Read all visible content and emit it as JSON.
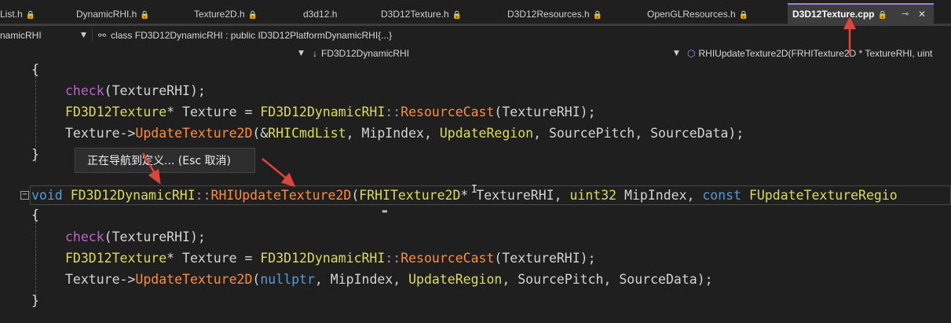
{
  "tabs": [
    {
      "label": "List.h",
      "locked": true
    },
    {
      "label": "DynamicRHI.h",
      "locked": true
    },
    {
      "label": "Texture2D.h",
      "locked": true
    },
    {
      "label": "d3d12.h",
      "locked": false
    },
    {
      "label": "D3D12Texture.h",
      "locked": true
    },
    {
      "label": "D3D12Resources.h",
      "locked": true
    },
    {
      "label": "OpenGLResources.h",
      "locked": true
    },
    {
      "label": "D3D12Texture.cpp",
      "locked": true,
      "active": true
    }
  ],
  "icons": {
    "lock": "🔒",
    "pin": "⊸",
    "close": "✕",
    "dropdown": "▼",
    "down_arrow": "↓",
    "class_icon": "⚯",
    "method_icon": "⬡"
  },
  "nav": {
    "project": "namicRHI",
    "scope": "class FD3D12DynamicRHI : public ID3D12PlatformDynamicRHI{...}",
    "class_member": "FD3D12DynamicRHI",
    "function": "RHIUpdateTexture2D(FRHITexture2D * TextureRHI, uint"
  },
  "code_lines": {
    "l1": "{",
    "l2_fn": "check",
    "l2_rest": "(TextureRHI);",
    "l3_t": "FD3D12Texture",
    "l3_a": "* Texture = ",
    "l3_c": "FD3D12DynamicRHI",
    "l3_s": "::",
    "l3_f": "ResourceCast",
    "l3_r": "(TextureRHI);",
    "l4_a": "Texture->",
    "l4_f": "UpdateTexture2D",
    "l4_b": "(&",
    "l4_v": "RHICmdList",
    "l4_c": ", MipIndex, ",
    "l4_u": "UpdateRegion",
    "l4_d": ", SourcePitch, SourceData);",
    "l5": "}",
    "l6_kw": "void",
    "l6_c": "FD3D12DynamicRHI",
    "l6_s": "::",
    "l6_f": "RHIUpdateTexture2D",
    "l6_p": "(",
    "l6_t": "FRHITexture2D",
    "l6_a": "* TextureRHI, ",
    "l6_u": "uint32",
    "l6_b": " MipIndex, ",
    "l6_k2": "const",
    "l6_t2": "FUpdateTextureRegio",
    "l7": "{",
    "l8_fn": "check",
    "l8_rest": "(TextureRHI);",
    "l9_t": "FD3D12Texture",
    "l9_a": "* Texture = ",
    "l9_c": "FD3D12DynamicRHI",
    "l9_s": "::",
    "l9_f": "ResourceCast",
    "l9_r": "(TextureRHI);",
    "l10_a": "Texture->",
    "l10_f": "UpdateTexture2D",
    "l10_b": "(",
    "l10_k": "nullptr",
    "l10_c": ", MipIndex, ",
    "l10_u": "UpdateRegion",
    "l10_d": ", SourcePitch, SourceData);",
    "l11": "}"
  },
  "tooltip": "正在导航到定义... (Esc 取消)",
  "colors": {
    "active_tab_accent": "#9d7fe0",
    "annotation_arrow": "#e0443a"
  }
}
